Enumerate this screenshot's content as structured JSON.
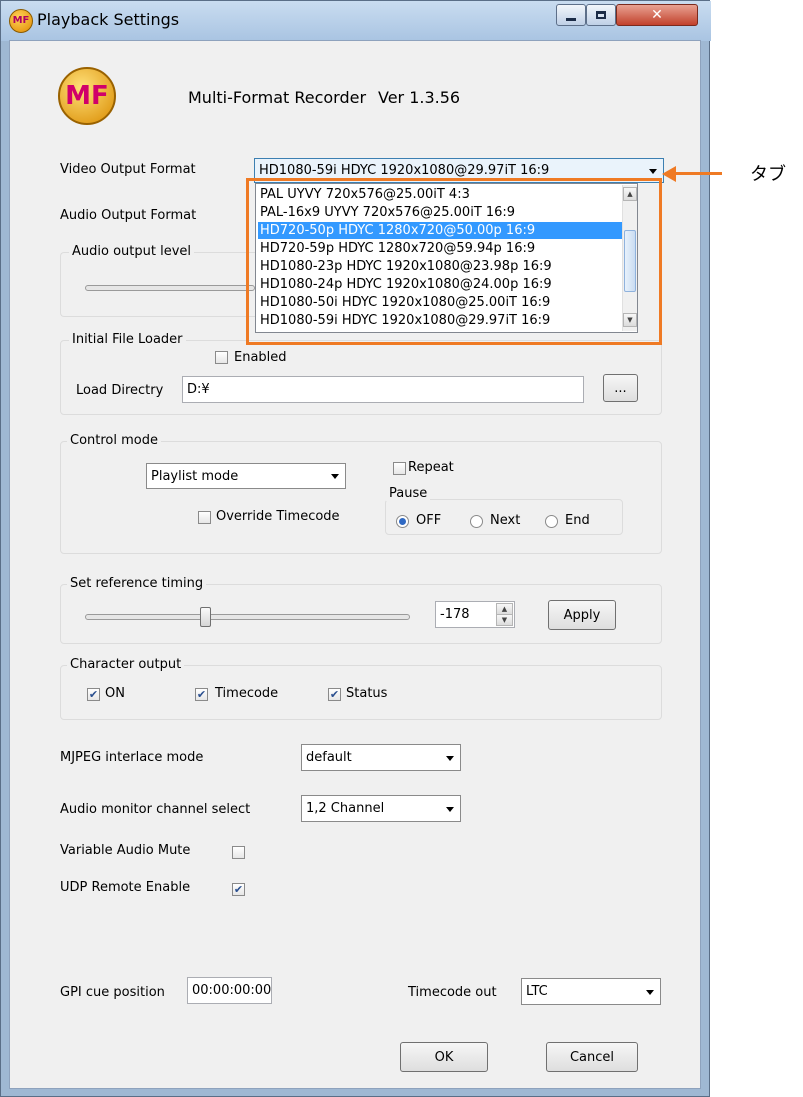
{
  "window": {
    "title": "Playback Settings",
    "app_icon_text": "MF"
  },
  "header": {
    "app_name": "Multi-Format Recorder",
    "version": "Ver 1.3.56",
    "logo_text": "MF"
  },
  "video_output": {
    "label": "Video Output Format",
    "selected": "HD1080-59i HDYC 1920x1080@29.97iT 16:9",
    "options": [
      {
        "label": "PAL UYVY 720x576@25.00iT 4:3",
        "selected": false
      },
      {
        "label": "PAL-16x9 UYVY 720x576@25.00iT 16:9",
        "selected": false
      },
      {
        "label": "HD720-50p HDYC 1280x720@50.00p 16:9",
        "selected": true
      },
      {
        "label": "HD720-59p HDYC 1280x720@59.94p 16:9",
        "selected": false
      },
      {
        "label": "HD1080-23p HDYC 1920x1080@23.98p 16:9",
        "selected": false
      },
      {
        "label": "HD1080-24p HDYC 1920x1080@24.00p 16:9",
        "selected": false
      },
      {
        "label": "HD1080-50i HDYC 1920x1080@25.00iT 16:9",
        "selected": false
      },
      {
        "label": "HD1080-59i HDYC 1920x1080@29.97iT 16:9",
        "selected": false
      }
    ]
  },
  "audio_output": {
    "label": "Audio Output Format"
  },
  "audio_level": {
    "label": "Audio output level"
  },
  "file_loader": {
    "group_label": "Initial File Loader",
    "enabled_label": "Enabled",
    "enabled": false,
    "directory_label": "Load Directry",
    "directory_value": "D:¥",
    "browse_label": "..."
  },
  "control_mode": {
    "group_label": "Control mode",
    "mode_value": "Playlist mode",
    "repeat_label": "Repeat",
    "repeat": false,
    "override_label": "Override Timecode",
    "override": false,
    "pause_label": "Pause",
    "pause_options": [
      "OFF",
      "Next",
      "End"
    ],
    "pause_selected": "OFF"
  },
  "reference_timing": {
    "group_label": "Set reference timing",
    "value": "-178",
    "apply_label": "Apply",
    "slider_fraction": 0.37
  },
  "character_output": {
    "group_label": "Character output",
    "items": [
      {
        "label": "ON",
        "checked": true
      },
      {
        "label": "Timecode",
        "checked": true
      },
      {
        "label": "Status",
        "checked": true
      }
    ]
  },
  "mjpeg": {
    "label": "MJPEG interlace mode",
    "value": "default"
  },
  "audio_monitor": {
    "label": "Audio monitor channel select",
    "value": "1,2 Channel"
  },
  "variable_audio_mute": {
    "label": "Variable Audio Mute",
    "checked": false
  },
  "udp_remote": {
    "label": "UDP Remote Enable",
    "checked": true
  },
  "gpi": {
    "label": "GPI cue position",
    "value": "00:00:00:00"
  },
  "timecode_out": {
    "label": "Timecode out",
    "value": "LTC"
  },
  "buttons": {
    "ok": "OK",
    "cancel": "Cancel"
  },
  "annotation": {
    "text": "タブ",
    "color": "#ef7a24"
  }
}
